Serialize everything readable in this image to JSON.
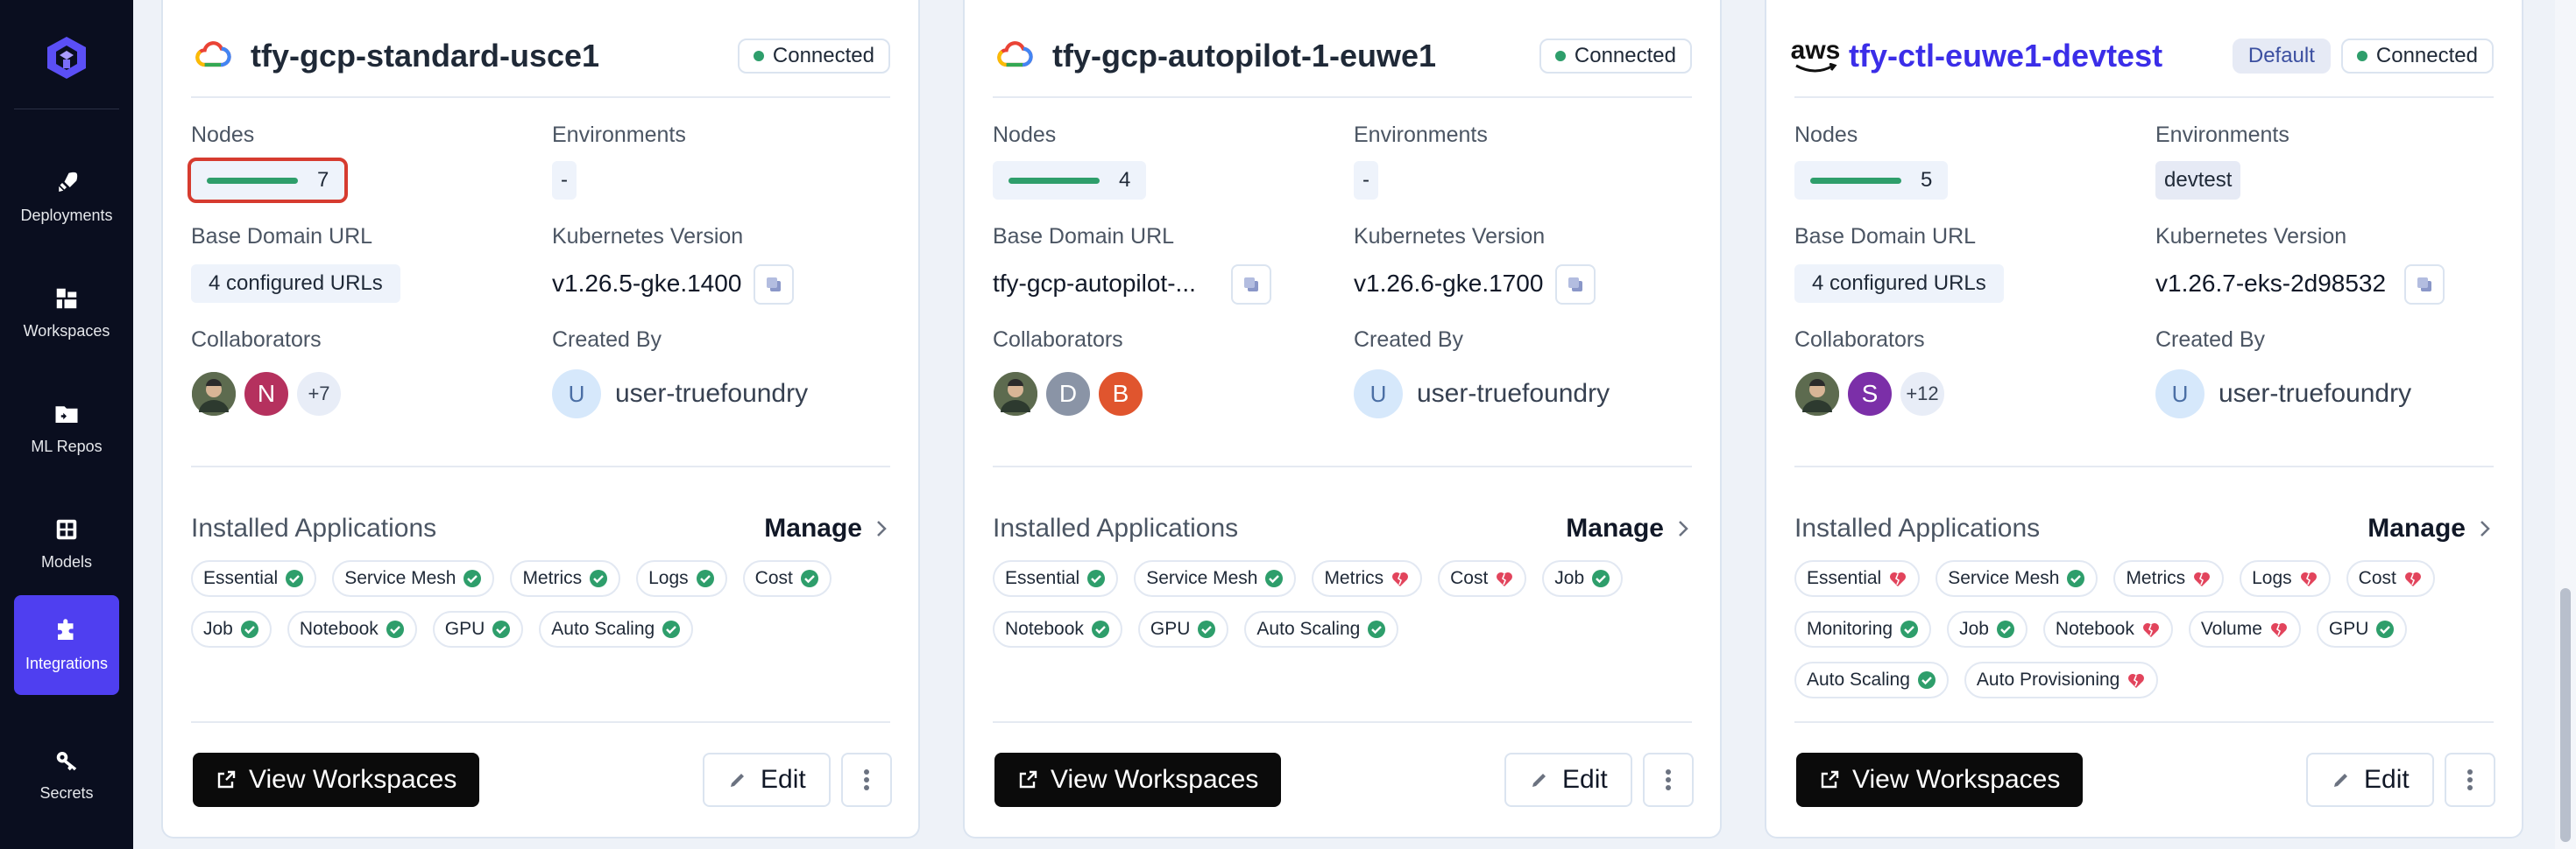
{
  "sidebar": {
    "items": [
      {
        "label": "Deployments",
        "icon": "rocket-icon"
      },
      {
        "label": "Workspaces",
        "icon": "workspaces-icon"
      },
      {
        "label": "ML Repos",
        "icon": "folder-icon"
      },
      {
        "label": "Models",
        "icon": "grid-icon"
      },
      {
        "label": "Integrations",
        "icon": "puzzle-icon",
        "active": true
      },
      {
        "label": "Secrets",
        "icon": "key-icon"
      }
    ]
  },
  "labels": {
    "nodes": "Nodes",
    "environments": "Environments",
    "base_domain_url": "Base Domain URL",
    "kubernetes_version": "Kubernetes Version",
    "collaborators": "Collaborators",
    "created_by": "Created By",
    "installed_applications": "Installed Applications",
    "manage": "Manage",
    "view_workspaces": "View Workspaces",
    "edit": "Edit",
    "connected": "Connected",
    "default": "Default"
  },
  "clusters": [
    {
      "name": "tfy-gcp-standard-usce1",
      "provider": "gcp",
      "nodes": "7",
      "environment": "-",
      "base_domain_url": "4 configured URLs",
      "kubernetes_version": "v1.26.5-gke.1400",
      "collaborators": [
        "",
        "N",
        "+7"
      ],
      "created_by_initial": "U",
      "created_by": "user-truefoundry",
      "apps": [
        {
          "name": "Essential",
          "ok": true
        },
        {
          "name": "Service Mesh",
          "ok": true
        },
        {
          "name": "Metrics",
          "ok": true
        },
        {
          "name": "Logs",
          "ok": true
        },
        {
          "name": "Cost",
          "ok": true
        },
        {
          "name": "Job",
          "ok": true
        },
        {
          "name": "Notebook",
          "ok": true
        },
        {
          "name": "GPU",
          "ok": true
        },
        {
          "name": "Auto Scaling",
          "ok": true
        }
      ]
    },
    {
      "name": "tfy-gcp-autopilot-1-euwe1",
      "provider": "gcp",
      "nodes": "4",
      "environment": "-",
      "base_domain_url": "tfy-gcp-autopilot-...",
      "kubernetes_version": "v1.26.6-gke.1700",
      "collaborators": [
        "",
        "D",
        "B"
      ],
      "created_by_initial": "U",
      "created_by": "user-truefoundry",
      "apps": [
        {
          "name": "Essential",
          "ok": true
        },
        {
          "name": "Service Mesh",
          "ok": true
        },
        {
          "name": "Metrics",
          "ok": false
        },
        {
          "name": "Cost",
          "ok": false
        },
        {
          "name": "Job",
          "ok": true
        },
        {
          "name": "Notebook",
          "ok": true
        },
        {
          "name": "GPU",
          "ok": true
        },
        {
          "name": "Auto Scaling",
          "ok": true
        }
      ]
    },
    {
      "name": "tfy-ctl-euwe1-devtest",
      "provider": "aws",
      "provider_text": "aws",
      "nodes": "5",
      "environment": "devtest",
      "base_domain_url": "4 configured URLs",
      "kubernetes_version": "v1.26.7-eks-2d98532",
      "collaborators": [
        "",
        "S",
        "+12"
      ],
      "created_by_initial": "U",
      "created_by": "user-truefoundry",
      "apps": [
        {
          "name": "Essential",
          "ok": false
        },
        {
          "name": "Service Mesh",
          "ok": true
        },
        {
          "name": "Metrics",
          "ok": false
        },
        {
          "name": "Logs",
          "ok": false
        },
        {
          "name": "Cost",
          "ok": false
        },
        {
          "name": "Monitoring",
          "ok": true
        },
        {
          "name": "Job",
          "ok": true
        },
        {
          "name": "Notebook",
          "ok": false
        },
        {
          "name": "Volume",
          "ok": false
        },
        {
          "name": "GPU",
          "ok": true
        },
        {
          "name": "Auto Scaling",
          "ok": true
        },
        {
          "name": "Auto Provisioning",
          "ok": false
        }
      ]
    }
  ],
  "colors": {
    "accent": "#4f3ff0",
    "connected_dot": "#2e9e6b",
    "highlight": "#d63b2f",
    "avatar_n": "#b5315e",
    "avatar_d": "#8a94a6",
    "avatar_b": "#e0552e",
    "avatar_s": "#7b2fa8"
  }
}
